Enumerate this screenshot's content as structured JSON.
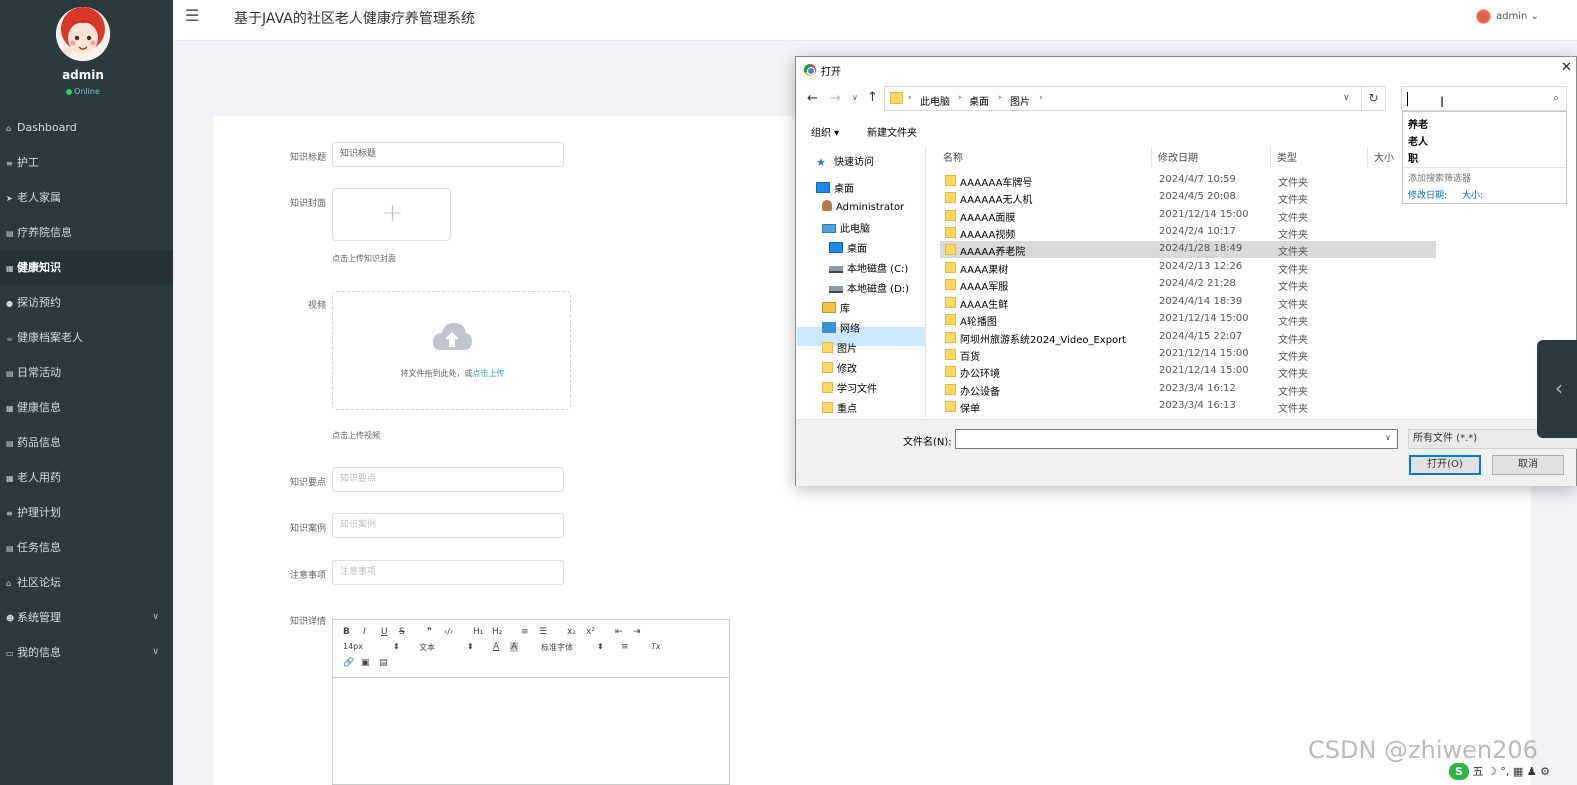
{
  "app": {
    "title": "基于JAVA的社区老人健康疗养管理系统",
    "user": "admin",
    "status": "Online"
  },
  "sidebar": {
    "items": [
      {
        "label": "Dashboard",
        "icon": "home-icon"
      },
      {
        "label": "护工",
        "icon": "list-icon"
      },
      {
        "label": "老人家属",
        "icon": "send-icon"
      },
      {
        "label": "疗养院信息",
        "icon": "doc-icon"
      },
      {
        "label": "健康知识",
        "icon": "grid-icon",
        "active": true
      },
      {
        "label": "探访预约",
        "icon": "pin-icon"
      },
      {
        "label": "健康档案老人",
        "icon": "cup-icon"
      },
      {
        "label": "日常活动",
        "icon": "doc-icon"
      },
      {
        "label": "健康信息",
        "icon": "grid-icon"
      },
      {
        "label": "药品信息",
        "icon": "doc-icon"
      },
      {
        "label": "老人用药",
        "icon": "grid-icon"
      },
      {
        "label": "护理计划",
        "icon": "list-icon"
      },
      {
        "label": "任务信息",
        "icon": "doc-icon"
      },
      {
        "label": "社区论坛",
        "icon": "bank-icon"
      },
      {
        "label": "系统管理",
        "icon": "user-icon",
        "expandable": true
      },
      {
        "label": "我的信息",
        "icon": "card-icon",
        "expandable": true
      }
    ]
  },
  "form": {
    "title_label": "知识标题",
    "title_value": "知识标题",
    "cover_label": "知识封面",
    "cover_hint": "点击上传知识封面",
    "video_label": "视频",
    "video_drop_text": "将文件拖到此处，或",
    "video_drop_link": "点击上传",
    "video_hint": "点击上传视频",
    "points_label": "知识要点",
    "points_placeholder": "知识要点",
    "case_label": "知识案例",
    "case_placeholder": "知识案例",
    "notes_label": "注意事项",
    "notes_placeholder": "注意事项",
    "detail_label": "知识详情",
    "editor": {
      "row1": [
        "B",
        "I",
        "U",
        "S",
        "❞",
        "‹/›",
        "H₁",
        "H₂",
        "≡",
        "☰",
        "x₂",
        "x²",
        "⇤",
        "⇥"
      ],
      "size": "14px",
      "format": "文本",
      "font": "标准字体",
      "clear": "Tx"
    }
  },
  "dialog": {
    "title": "打开",
    "path": [
      "此电脑",
      "桌面",
      "图片"
    ],
    "organize": "组织 ▾",
    "new_folder": "新建文件夹",
    "nav": [
      {
        "label": "快速访问",
        "icon": "star-icon"
      },
      {
        "label": "桌面",
        "icon": "desktop-icon"
      },
      {
        "label": "Administrator",
        "icon": "user-folder-icon"
      },
      {
        "label": "此电脑",
        "icon": "pc-icon"
      },
      {
        "label": "桌面",
        "icon": "desktop-icon",
        "selected": true
      },
      {
        "label": "本地磁盘 (C:)",
        "icon": "drive-icon"
      },
      {
        "label": "本地磁盘 (D:)",
        "icon": "drive-icon"
      },
      {
        "label": "库",
        "icon": "library-icon"
      },
      {
        "label": "网络",
        "icon": "network-icon"
      },
      {
        "label": "图片",
        "icon": "folder-icon"
      },
      {
        "label": "修改",
        "icon": "folder-icon"
      },
      {
        "label": "学习文件",
        "icon": "folder-icon"
      },
      {
        "label": "重点",
        "icon": "folder-icon"
      }
    ],
    "columns": {
      "name": "名称",
      "date": "修改日期",
      "type": "类型",
      "size": "大小"
    },
    "files": [
      {
        "name": "AAAAAA车牌号",
        "date": "2024/4/7 10:59",
        "type": "文件夹"
      },
      {
        "name": "AAAAAA无人机",
        "date": "2024/4/5 20:08",
        "type": "文件夹"
      },
      {
        "name": "AAAAA面膜",
        "date": "2021/12/14 15:00",
        "type": "文件夹"
      },
      {
        "name": "AAAAA视频",
        "date": "2024/2/4 10:17",
        "type": "文件夹"
      },
      {
        "name": "AAAAA养老院",
        "date": "2024/1/28 18:49",
        "type": "文件夹",
        "selected": true
      },
      {
        "name": "AAAA果树",
        "date": "2024/2/13 12:26",
        "type": "文件夹"
      },
      {
        "name": "AAAA军服",
        "date": "2024/4/2 21:28",
        "type": "文件夹"
      },
      {
        "name": "AAAA生鲜",
        "date": "2024/4/14 18:39",
        "type": "文件夹"
      },
      {
        "name": "A轮播图",
        "date": "2021/12/14 15:00",
        "type": "文件夹"
      },
      {
        "name": "阿坝州旅游系统2024_Video_Export",
        "date": "2024/4/15 22:07",
        "type": "文件夹"
      },
      {
        "name": "百货",
        "date": "2021/12/14 15:00",
        "type": "文件夹"
      },
      {
        "name": "办公环境",
        "date": "2021/12/14 15:00",
        "type": "文件夹"
      },
      {
        "name": "办公设备",
        "date": "2023/3/4 16:12",
        "type": "文件夹"
      },
      {
        "name": "保单",
        "date": "2023/3/4 16:13",
        "type": "文件夹"
      }
    ],
    "filename_label": "文件名(N):",
    "filename_value": "",
    "filetype": "所有文件 (*.*)",
    "open_button": "打开(O)",
    "cancel_button": "取消",
    "search_value": "",
    "suggestions": [
      "养老",
      "老人",
      "职"
    ],
    "add_filter": "添加搜索筛选器",
    "filter_date": "修改日期:",
    "filter_size": "大小:"
  },
  "watermark": "CSDN @zhiwen206",
  "ime": {
    "logo": "S",
    "text": "五 ☽ °, ▦ ♟ ⚙"
  },
  "colors": {
    "sidebar_bg": "#2b3a3e",
    "accent": "#29b29d",
    "dialog_selection": "#cce8ff"
  }
}
